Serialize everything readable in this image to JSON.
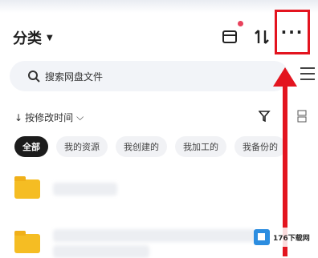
{
  "header": {
    "title": "分类",
    "more_label": "···"
  },
  "search": {
    "placeholder": "搜索网盘文件"
  },
  "sort": {
    "label": "按修改时间"
  },
  "tabs": [
    {
      "label": "全部",
      "active": true
    },
    {
      "label": "我的资源"
    },
    {
      "label": "我创建的"
    },
    {
      "label": "我加工的"
    },
    {
      "label": "我备份的"
    }
  ],
  "watermark": {
    "text": "176下载网"
  },
  "colors": {
    "accent_red": "#e3141f",
    "folder": "#f5bd23",
    "badge": "#e8425c",
    "chip_active": "#1c1c1c"
  }
}
